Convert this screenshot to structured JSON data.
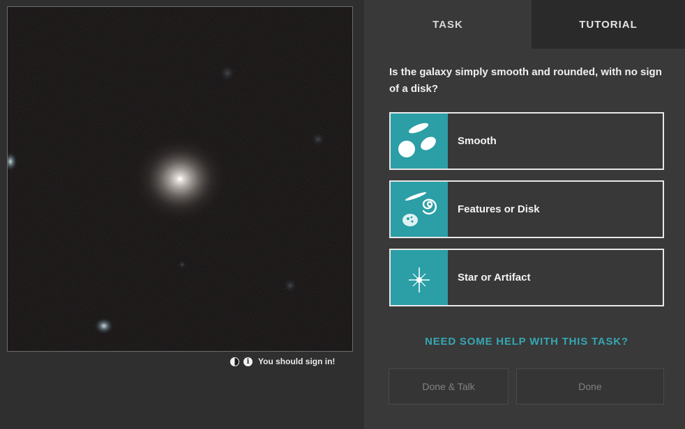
{
  "subject_viewer": {
    "signin_notice": "You should sign in!",
    "icons": [
      "contrast-icon",
      "info-icon"
    ]
  },
  "tabs": [
    {
      "label": "TASK",
      "active": true
    },
    {
      "label": "TUTORIAL",
      "active": false
    }
  ],
  "task": {
    "question": "Is the galaxy simply smooth and rounded, with no sign of a disk?",
    "answers": [
      {
        "label": "Smooth",
        "icon": "smooth-galaxies-icon"
      },
      {
        "label": "Features or Disk",
        "icon": "features-disk-icon"
      },
      {
        "label": "Star or Artifact",
        "icon": "star-artifact-icon"
      }
    ],
    "help_link": "NEED SOME HELP WITH THIS TASK?",
    "buttons": {
      "done_talk": "Done & Talk",
      "done": "Done"
    }
  },
  "colors": {
    "accent": "#2b9ea6",
    "help_link": "#35a7b2",
    "panel_bg": "#393939",
    "page_bg": "#2f2f2f"
  }
}
